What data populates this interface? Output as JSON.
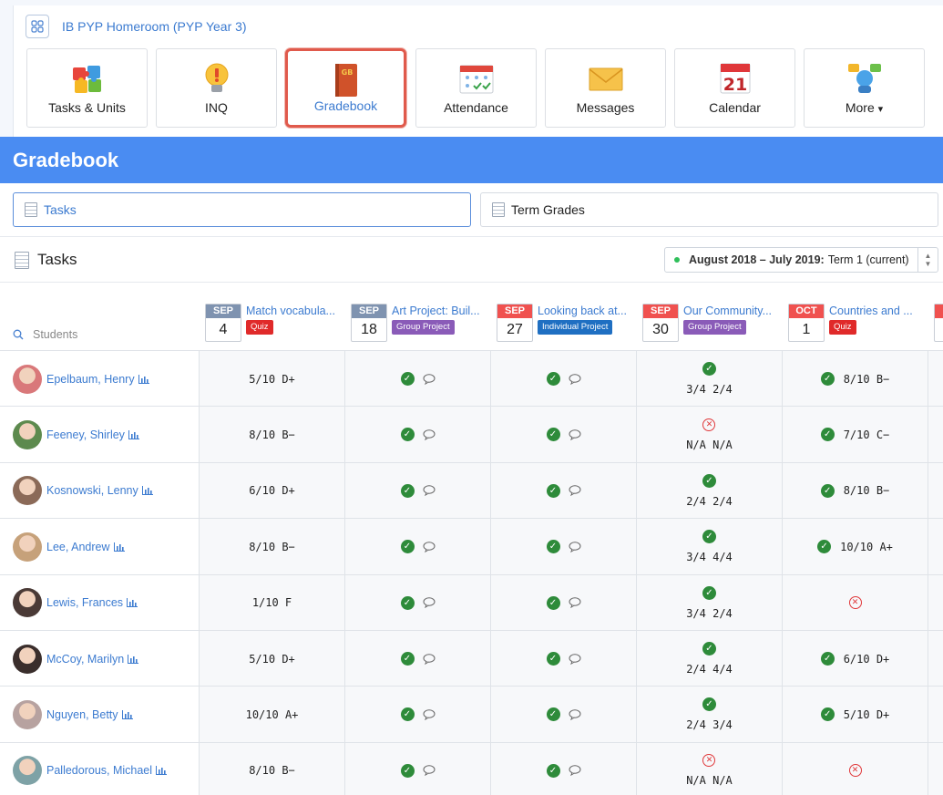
{
  "class": {
    "title": "IB PYP Homeroom (PYP Year 3)"
  },
  "apps": [
    {
      "label": "Tasks & Units",
      "icon": "puzzle-icon"
    },
    {
      "label": "INQ",
      "icon": "lightbulb-icon"
    },
    {
      "label": "Gradebook",
      "icon": "gradebook-icon",
      "active": true
    },
    {
      "label": "Attendance",
      "icon": "attendance-icon"
    },
    {
      "label": "Messages",
      "icon": "envelope-icon"
    },
    {
      "label": "Calendar",
      "icon": "calendar-icon"
    },
    {
      "label": "More",
      "icon": "people-chat-icon"
    }
  ],
  "calendar_icon_day": "21",
  "gradebook_icon_text": "GB",
  "more_caret": "▾",
  "header": {
    "title": "Gradebook"
  },
  "tabs": {
    "tasks": "Tasks",
    "term_grades": "Term Grades"
  },
  "section": {
    "title": "Tasks"
  },
  "term": {
    "range": "August 2018 – July 2019:",
    "name": "Term 1 (current)"
  },
  "students_label": "Students",
  "tasks": [
    {
      "month": "SEP",
      "day": "4",
      "title": "Match vocabula...",
      "badge": "Quiz",
      "month_color": "#7f93b0",
      "badge_color": "#e02a2a"
    },
    {
      "month": "SEP",
      "day": "18",
      "title": "Art Project: Buil...",
      "badge": "Group Project",
      "month_color": "#7f93b0",
      "badge_color": "#8a5bb8"
    },
    {
      "month": "SEP",
      "day": "27",
      "title": "Looking back at...",
      "badge": "Individual Project",
      "month_color": "#f0514f",
      "badge_color": "#1f6fc2"
    },
    {
      "month": "SEP",
      "day": "30",
      "title": "Our Community...",
      "badge": "Group Project",
      "month_color": "#f0514f",
      "badge_color": "#8a5bb8"
    },
    {
      "month": "OCT",
      "day": "1",
      "title": "Countries and ...",
      "badge": "Quiz",
      "month_color": "#f0514f",
      "badge_color": "#e02a2a"
    }
  ],
  "students": [
    {
      "name": "Epelbaum, Henry",
      "avatar_color": "#d9787a",
      "grades": [
        "5/10 D+",
        "ok",
        "ok",
        {
          "status": "ok",
          "scores": "3/4  2/4"
        },
        {
          "status": "ok",
          "text": "8/10 B−"
        }
      ]
    },
    {
      "name": "Feeney, Shirley",
      "avatar_color": "#5d8a4e",
      "grades": [
        "8/10 B−",
        "ok",
        "ok",
        {
          "status": "bad",
          "scores": "N/A  N/A"
        },
        {
          "status": "ok",
          "text": "7/10 C−"
        }
      ]
    },
    {
      "name": "Kosnowski, Lenny",
      "avatar_color": "#8b6a58",
      "grades": [
        "6/10 D+",
        "ok",
        "ok",
        {
          "status": "ok",
          "scores": "2/4  2/4"
        },
        {
          "status": "ok",
          "text": "8/10 B−"
        }
      ]
    },
    {
      "name": "Lee, Andrew",
      "avatar_color": "#c6a17a",
      "grades": [
        "8/10 B−",
        "ok",
        "ok",
        {
          "status": "ok",
          "scores": "3/4  4/4"
        },
        {
          "status": "ok",
          "text": "10/10 A+"
        }
      ]
    },
    {
      "name": "Lewis, Frances",
      "avatar_color": "#4a3a36",
      "grades": [
        "1/10 F",
        "ok",
        "ok",
        {
          "status": "ok",
          "scores": "3/4  2/4"
        },
        {
          "status": "bad",
          "text": ""
        }
      ]
    },
    {
      "name": "McCoy, Marilyn",
      "avatar_color": "#3a2e2c",
      "grades": [
        "5/10 D+",
        "ok",
        "ok",
        {
          "status": "ok",
          "scores": "2/4  4/4"
        },
        {
          "status": "ok",
          "text": "6/10 D+"
        }
      ]
    },
    {
      "name": "Nguyen, Betty",
      "avatar_color": "#b7a2a0",
      "grades": [
        "10/10 A+",
        "ok",
        "ok",
        {
          "status": "ok",
          "scores": "2/4  3/4"
        },
        {
          "status": "ok",
          "text": "5/10 D+"
        }
      ]
    },
    {
      "name": "Palledorous, Michael",
      "avatar_color": "#7ea2a6",
      "grades": [
        "8/10 B−",
        "ok",
        "ok",
        {
          "status": "bad",
          "scores": "N/A  N/A"
        },
        {
          "status": "bad",
          "text": ""
        }
      ]
    }
  ]
}
